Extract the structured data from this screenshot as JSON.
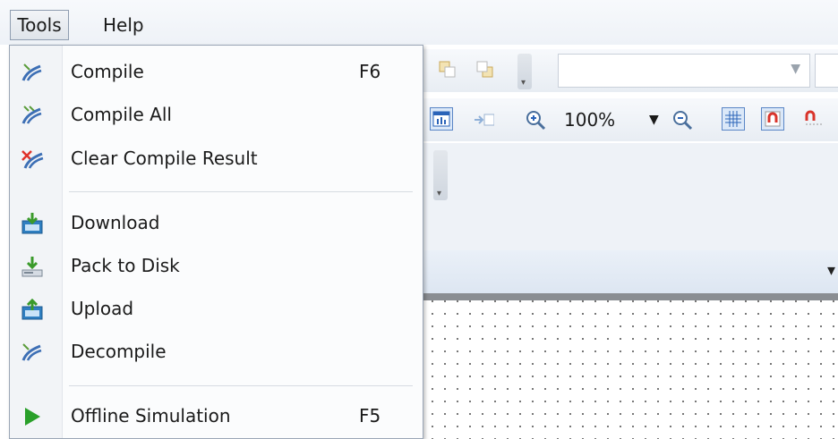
{
  "menubar": {
    "items": [
      {
        "label": "Tools",
        "state": "open"
      },
      {
        "label": "Help"
      }
    ]
  },
  "tools_menu": {
    "items": [
      {
        "label": "Compile",
        "shortcut": "F6",
        "icon": "compile-icon"
      },
      {
        "label": "Compile All",
        "shortcut": "",
        "icon": "compile-all-icon"
      },
      {
        "label": "Clear Compile Result",
        "shortcut": "",
        "icon": "clear-compile-icon"
      },
      {
        "label": "Download",
        "shortcut": "",
        "icon": "download-icon"
      },
      {
        "label": "Pack to Disk",
        "shortcut": "",
        "icon": "pack-to-disk-icon"
      },
      {
        "label": "Upload",
        "shortcut": "",
        "icon": "upload-icon"
      },
      {
        "label": "Decompile",
        "shortcut": "",
        "icon": "decompile-icon"
      },
      {
        "label": "Offline Simulation",
        "shortcut": "F5",
        "icon": "play-icon"
      }
    ]
  },
  "toolbar": {
    "zoom_value": "100%",
    "style_dropdown_value": ""
  },
  "colors": {
    "accent": "#2a63b8",
    "menu_border": "#9aa6b6",
    "play_green": "#2aa02a"
  }
}
